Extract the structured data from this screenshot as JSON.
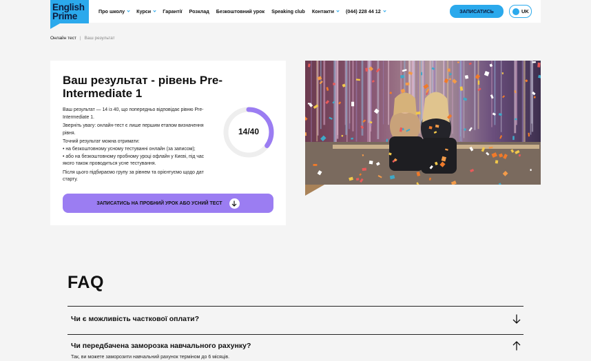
{
  "header": {
    "logo_line1": "English",
    "logo_line2": "Prime",
    "nav": [
      {
        "label": "Про школу",
        "dropdown": true
      },
      {
        "label": "Курси",
        "dropdown": true
      },
      {
        "label": "Гарантії",
        "dropdown": false
      },
      {
        "label": "Розклад",
        "dropdown": false
      },
      {
        "label": "Безкоштовний урок",
        "dropdown": false
      },
      {
        "label": "Speaking club",
        "dropdown": false
      },
      {
        "label": "Контакти",
        "dropdown": true
      },
      {
        "label": "(044) 228 44 12",
        "dropdown": true
      }
    ],
    "cta_label": "ЗАПИСАТИСЬ",
    "lang_label": "UK"
  },
  "breadcrumb": {
    "link": "Онлайн тест",
    "separator": "|",
    "current": "Ваш результат"
  },
  "result": {
    "title": "Ваш результат - рівень Pre-Intermediate 1",
    "p1": "Ваш результат — 14 із 40, що попередньо відповідає рівню Pre-Intermediate 1.",
    "p2": "Зверніть увагу: онлайн-тест є лише першим етапом визначення рівня.",
    "p3_intro": "Точний результат можна отримати:",
    "p3_item1": "• на безкоштовному усному тестуванні онлайн (за записом);",
    "p3_item2": "• або на безкоштовному пробному уроці офлайн у Києві, під час якого також проводиться усне тестування.",
    "p4": "Після цього підбираємо групу за рівнем та орієнтуємо щодо дат старту.",
    "score_text": "14/40",
    "score_value": 14,
    "score_max": 40,
    "cta_label": "ЗАПИСАТИСЬ НА ПРОБНИЙ УРОК АБО УСНИЙ ТЕСТ"
  },
  "faq": {
    "title": "FAQ",
    "items": [
      {
        "question": "Чи є можливість часткової оплати?",
        "expanded": false
      },
      {
        "question": "Чи передбачена заморозка навчального рахунку?",
        "expanded": true
      }
    ],
    "answer_partial": "Так, ви можете заморозити навчальний рахунок терміном до 6 місяців."
  },
  "colors": {
    "brand_blue": "#2ba9ec",
    "cta_purple": "#9b7df2",
    "ring_track": "#eeeeee"
  }
}
